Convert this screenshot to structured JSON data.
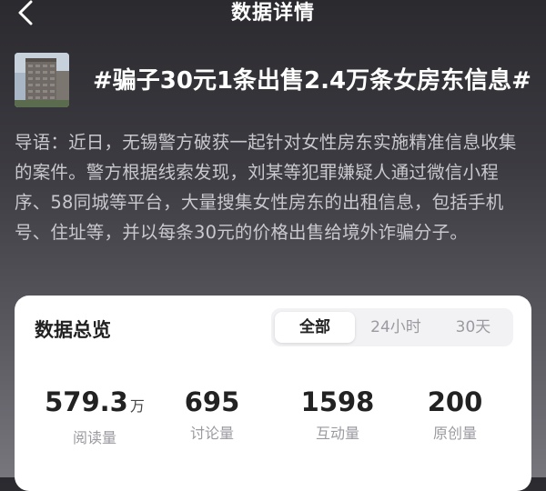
{
  "header": {
    "title": "数据详情",
    "back_icon": "chevron-left-icon"
  },
  "topic": {
    "title": "#骗子30元1条出售2.4万条女房东信息#",
    "thumbnail": "building-photo"
  },
  "intro": {
    "text": "导语：近日，无锡警方破获一起针对女性房东实施精准信息收集的案件。警方根据线索发现，刘某等犯罪嫌疑人通过微信小程序、58同城等平台，大量搜集女性房东的出租信息，包括手机号、住址等，并以每条30元的价格出售给境外诈骗分子。"
  },
  "overview": {
    "title": "数据总览",
    "tabs": [
      "全部",
      "24小时",
      "30天"
    ],
    "active_tab": "全部",
    "stats": [
      {
        "value": "579.3",
        "unit": "万",
        "label": "阅读量"
      },
      {
        "value": "695",
        "unit": "",
        "label": "讨论量"
      },
      {
        "value": "1598",
        "unit": "",
        "label": "互动量"
      },
      {
        "value": "200",
        "unit": "",
        "label": "原创量"
      }
    ]
  },
  "colors": {
    "text_primary": "#222222",
    "text_muted": "#9a9aa0",
    "intro_text": "#c9c8cd"
  }
}
